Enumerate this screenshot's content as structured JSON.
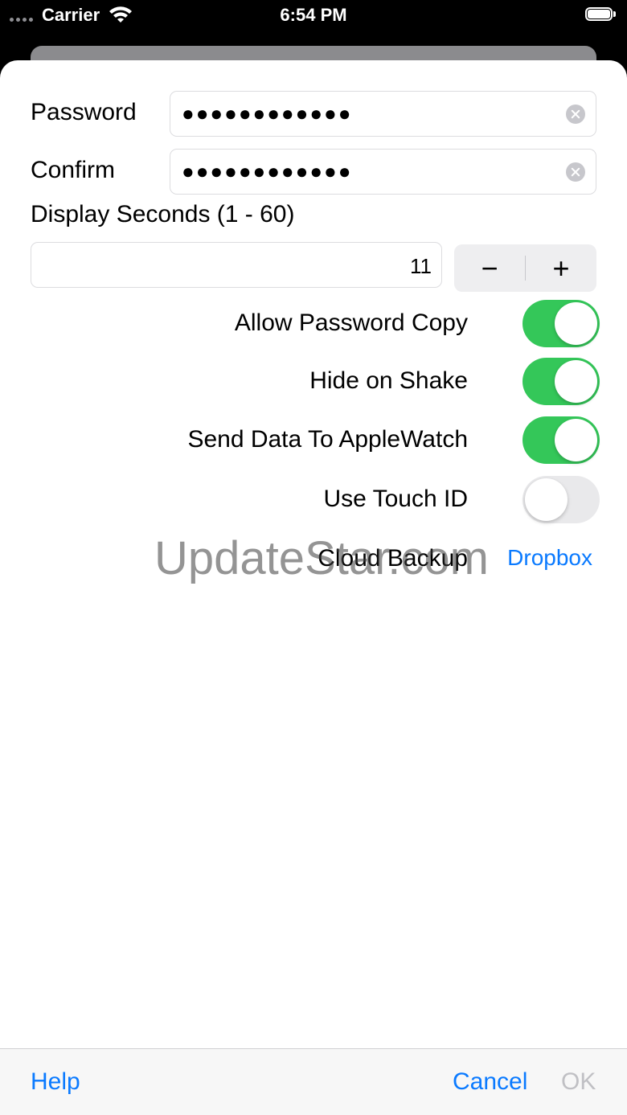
{
  "status_bar": {
    "carrier": "Carrier",
    "time": "6:54 PM",
    "icons": [
      "signal-dots-icon",
      "wifi-icon",
      "battery-icon"
    ]
  },
  "form": {
    "password": {
      "label": "Password",
      "value": "●●●●●●●●●●●●",
      "icon": "clear-icon"
    },
    "confirm": {
      "label": "Confirm",
      "value": "●●●●●●●●●●●●",
      "icon": "clear-icon"
    },
    "display_seconds": {
      "label": "Display Seconds (1 - 60)",
      "value": "11",
      "minus": "−",
      "plus": "+"
    },
    "toggles": [
      {
        "label": "Allow Password Copy",
        "on": true
      },
      {
        "label": "Hide on Shake",
        "on": true
      },
      {
        "label": "Send Data To AppleWatch",
        "on": true
      },
      {
        "label": "Use Touch ID",
        "on": false
      }
    ],
    "cloud_backup": {
      "label": "Cloud Backup",
      "value": "Dropbox"
    }
  },
  "watermark": "UpdateStar.com",
  "toolbar": {
    "help": "Help",
    "cancel": "Cancel",
    "ok": "OK"
  },
  "colors": {
    "accent": "#0a7aff",
    "toggle_on": "#34c759",
    "toggle_off": "#e9e9eb",
    "disabled": "#c0c0c4"
  }
}
